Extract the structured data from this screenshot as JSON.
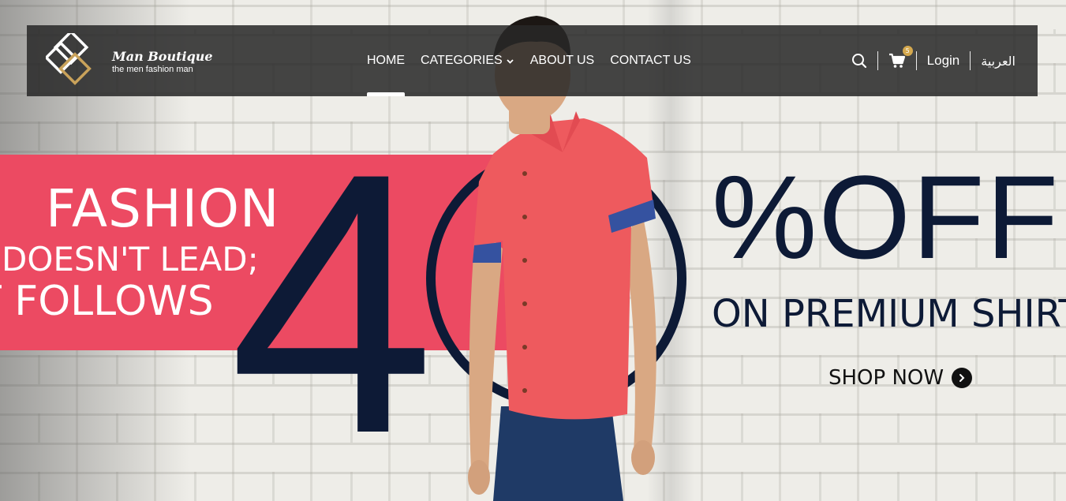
{
  "brand": {
    "title": "Man Boutique",
    "tagline": "the men fashion man",
    "logo_icon": "diamond-logo-icon",
    "gold": "#c9a25a"
  },
  "nav": {
    "items": [
      {
        "label": "HOME",
        "active": true
      },
      {
        "label": "CATEGORIES",
        "has_dropdown": true
      },
      {
        "label": "ABOUT US"
      },
      {
        "label": "CONTACT US"
      }
    ]
  },
  "tools": {
    "search_icon": "search-icon",
    "cart_icon": "cart-icon",
    "cart_count": "5",
    "login_label": "Login",
    "language_label": "العربية"
  },
  "hero": {
    "headline_line1": "FASHION",
    "headline_line2": "DOESN'T LEAD;",
    "headline_line3": "T FOLLOWS",
    "big_digit": "4",
    "percent_off": "%OFF",
    "subline": "ON PREMIUM SHIRT",
    "cta_label": "SHOP NOW",
    "accent_pink": "#ec4a62",
    "navy": "#0d1a36"
  }
}
